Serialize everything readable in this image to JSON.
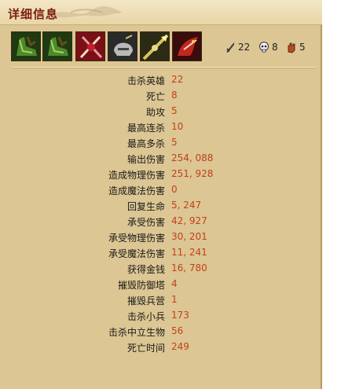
{
  "header": {
    "title": "详细信息"
  },
  "items": [
    {
      "icon": "green-boots-icon"
    },
    {
      "icon": "green-boots-icon"
    },
    {
      "icon": "red-crossed-swords-icon"
    },
    {
      "icon": "silver-helmet-icon"
    },
    {
      "icon": "golden-lance-icon"
    },
    {
      "icon": "red-dragon-icon"
    }
  ],
  "summary": {
    "kills": "22",
    "deaths": "8",
    "assists": "5"
  },
  "stats": [
    {
      "label": "击杀英雄",
      "value": "22"
    },
    {
      "label": "死亡",
      "value": "8"
    },
    {
      "label": "助攻",
      "value": "5"
    },
    {
      "label": "最高连杀",
      "value": "10"
    },
    {
      "label": "最高多杀",
      "value": "5"
    },
    {
      "label": "输出伤害",
      "value": "254, 088"
    },
    {
      "label": "造成物理伤害",
      "value": "251, 928"
    },
    {
      "label": "造成魔法伤害",
      "value": "0"
    },
    {
      "label": "回复生命",
      "value": "5, 247"
    },
    {
      "label": "承受伤害",
      "value": "42, 927"
    },
    {
      "label": "承受物理伤害",
      "value": "30, 201"
    },
    {
      "label": "承受魔法伤害",
      "value": "11, 241"
    },
    {
      "label": "获得金钱",
      "value": "16, 780"
    },
    {
      "label": "摧毁防御塔",
      "value": "4"
    },
    {
      "label": "摧毁兵营",
      "value": "1"
    },
    {
      "label": "击杀小兵",
      "value": "173"
    },
    {
      "label": "击杀中立生物",
      "value": "56"
    },
    {
      "label": "死亡时间",
      "value": "249"
    }
  ],
  "colors": {
    "panel_bg": "#dcc693",
    "title_text": "#7a1f10",
    "value_text": "#c2401b",
    "label_text": "#1a1a1a"
  }
}
